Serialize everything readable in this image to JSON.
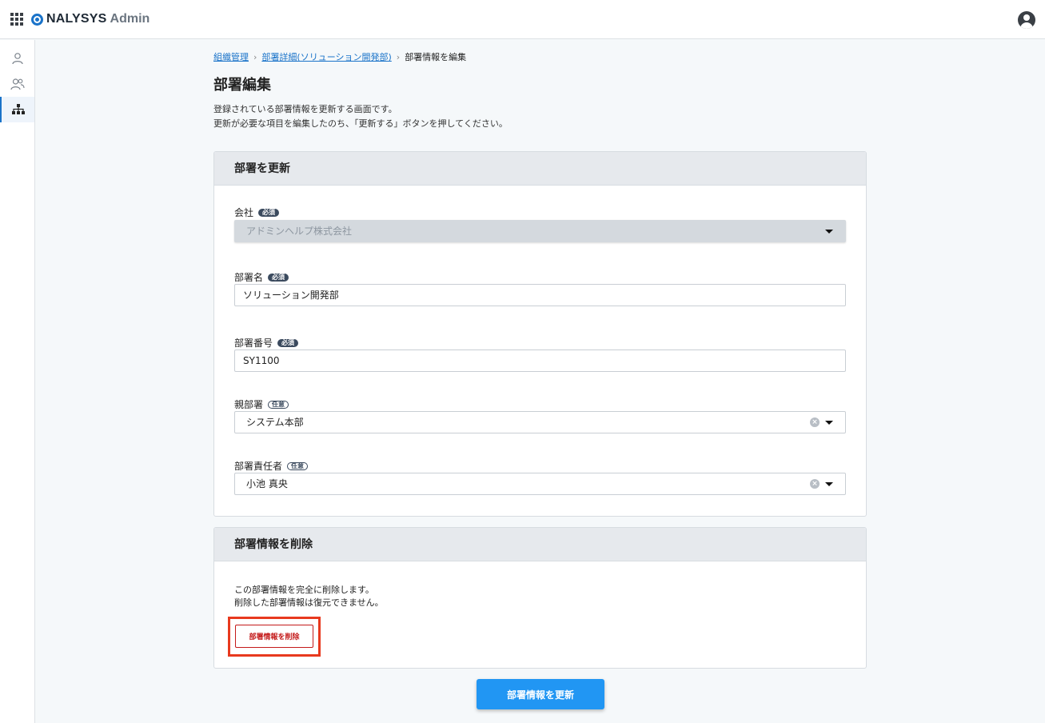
{
  "app": {
    "logo_text": "NALYSYS",
    "logo_sub": "Admin"
  },
  "breadcrumb": {
    "item1": "組織管理",
    "item2": "部署詳細(ソリューション開発部)",
    "current": "部署情報を編集",
    "separator": "›"
  },
  "page": {
    "title": "部署編集",
    "description_line1": "登録されている部署情報を更新する画面です。",
    "description_line2": "更新が必要な項目を編集したのち、「更新する」ボタンを押してください。"
  },
  "update_card": {
    "title": "部署を更新",
    "company": {
      "label": "会社",
      "badge": "必須",
      "value": "アドミンヘルプ株式会社"
    },
    "dept_name": {
      "label": "部署名",
      "badge": "必須",
      "value": "ソリューション開発部"
    },
    "dept_number": {
      "label": "部署番号",
      "badge": "必須",
      "value": "SY1100"
    },
    "parent_dept": {
      "label": "親部署",
      "badge": "任意",
      "value": "システム本部"
    },
    "manager": {
      "label": "部署責任者",
      "badge": "任意",
      "value": "小池 真央"
    }
  },
  "delete_card": {
    "title": "部署情報を削除",
    "text_line1": "この部署情報を完全に削除します。",
    "text_line2": "削除した部署情報は復元できません。",
    "button_label": "部署情報を削除"
  },
  "submit_label": "部署情報を更新",
  "colors": {
    "accent": "#2196f3",
    "danger": "#c41a1a",
    "highlight": "#e8391e",
    "link": "#1a73c9"
  }
}
